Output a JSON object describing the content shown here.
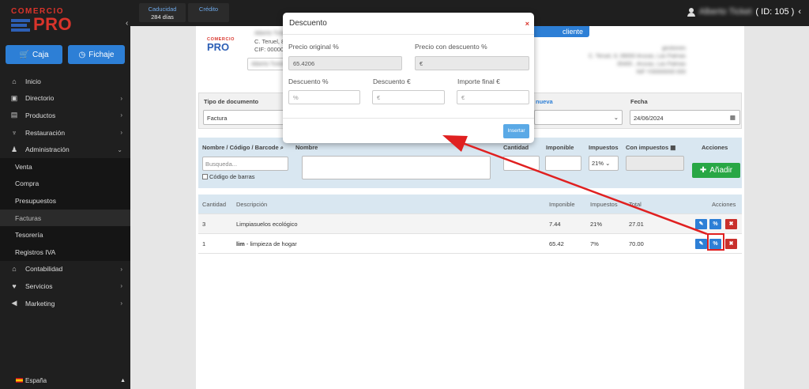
{
  "brand": {
    "line1": "COMERCIO",
    "line2": "PRO"
  },
  "sidebar": {
    "btn_caja": "Caja",
    "btn_fichaje": "Fichaje",
    "items": [
      {
        "label": "Inicio",
        "icon": "home-icon"
      },
      {
        "label": "Directorio",
        "icon": "contacts-icon"
      },
      {
        "label": "Productos",
        "icon": "products-icon"
      },
      {
        "label": "Restauración",
        "icon": "restaurant-icon"
      },
      {
        "label": "Administración",
        "icon": "admin-icon"
      }
    ],
    "sub_items": [
      "Venta",
      "Compra",
      "Presupuestos",
      "Facturas",
      "Tesorería",
      "Registros IVA"
    ],
    "items2": [
      {
        "label": "Contabilidad",
        "icon": "bank-icon"
      },
      {
        "label": "Servicios",
        "icon": "heart-icon"
      },
      {
        "label": "Marketing",
        "icon": "megaphone-icon"
      }
    ],
    "language": "España"
  },
  "topbar": {
    "tab1_label": "Caducidad",
    "tab1_value": "284 días",
    "tab2_label": "Crédito",
    "user_name": "Alberto Ticket",
    "user_id": "( ID: 105 )"
  },
  "document": {
    "logo_line1": "COMERCIO",
    "logo_line2": "PRO",
    "company_name": "Alberto Ticket",
    "address": "C. Teruel, 8",
    "cif": "CIF: 00000",
    "select_placeholder": "Alberto Ticket",
    "right_info": [
      "gestiones",
      "C. Teruel, 8, 08000 Arucas, Las Palmas",
      "35400 , Arucas, Las Palmas",
      "NIF Y00000000 000"
    ],
    "nuevo_cliente": "cliente",
    "tipo_label": "Tipo de documento",
    "tipo_value": "Factura",
    "serie_label": "nueva",
    "fecha_label": "Fecha",
    "fecha_value": "24/06/2024"
  },
  "product_form": {
    "h_nombre_codigo": "Nombre / Código / Barcode",
    "h_nombre": "Nombre",
    "h_cantidad": "Cantidad",
    "h_imponible": "Imponible",
    "h_impuestos": "Impuestos",
    "h_con_impuestos": "Con impuestos",
    "h_acciones": "Acciones",
    "search_placeholder": "Busqueda...",
    "checkbox_label": "Código de barras",
    "tax_value": "21%",
    "add_button": "Añadir"
  },
  "lines_table": {
    "headers": [
      "Cantidad",
      "Descripción",
      "Imponible",
      "Impuestos",
      "Total",
      "Acciones"
    ],
    "rows": [
      {
        "cantidad": "3",
        "desc_bold": "",
        "descripcion": "Limpiasuelos ecológico",
        "imponible": "7.44",
        "impuestos": "21%",
        "total": "27.01"
      },
      {
        "cantidad": "1",
        "desc_bold": "lim",
        "descripcion": " - limpieza de hogar",
        "imponible": "65.42",
        "impuestos": "7%",
        "total": "70.00"
      }
    ]
  },
  "modal": {
    "title": "Descuento",
    "close": "×",
    "precio_original_label": "Precio original %",
    "precio_original_value": "65.4206",
    "precio_descuento_label": "Precio con descuento %",
    "precio_descuento_value": "€",
    "descuento_pct_label": "Descuento %",
    "descuento_pct_placeholder": "%",
    "descuento_eur_label": "Descuento €",
    "descuento_eur_placeholder": "€",
    "importe_final_label": "Importe final €",
    "importe_final_placeholder": "€",
    "insert_button": "Insertar"
  },
  "colors": {
    "accent": "#2d7fd6",
    "brand_red": "#d9342b",
    "annotation": "#e02020"
  }
}
